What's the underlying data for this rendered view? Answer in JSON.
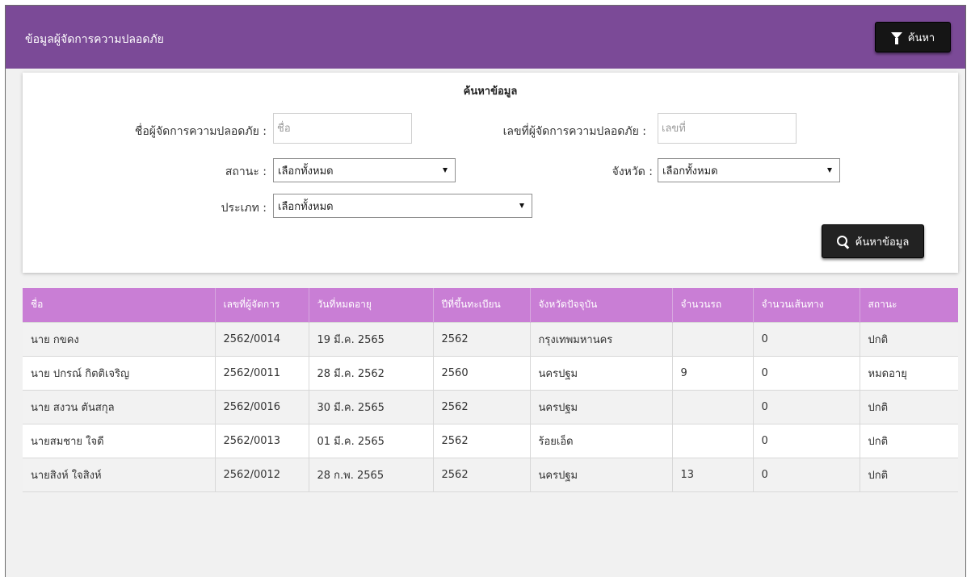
{
  "header": {
    "title": "ข้อมูลผู้จัดการความปลอดภัย",
    "filter_button": "ค้นหา"
  },
  "search": {
    "panel_title": "ค้นหาข้อมูล",
    "name_label": "ชื่อผู้จัดการความปลอดภัย :",
    "name_placeholder": "ชื่อ",
    "number_label": "เลขที่ผู้จัดการความปลอดภัย :",
    "number_placeholder": "เลขที่",
    "status_label": "สถานะ :",
    "status_value": "เลือกทั้งหมด",
    "province_label": "จังหวัด :",
    "province_value": "เลือกทั้งหมด",
    "type_label": "ประเภท :",
    "type_value": "เลือกทั้งหมด",
    "search_button": "ค้นหาข้อมูล"
  },
  "table": {
    "headers": [
      "ชื่อ",
      "เลขที่ผู้จัดการ",
      "วันที่หมดอายุ",
      "ปีที่ขึ้นทะเบียน",
      "จังหวัดปัจจุบัน",
      "จำนวนรถ",
      "จำนวนเส้นทาง",
      "สถานะ"
    ],
    "rows": [
      [
        "นาย กขคง",
        "2562/0014",
        "19 มี.ค. 2565",
        "2562",
        "กรุงเทพมหานคร",
        "",
        "0",
        "ปกติ"
      ],
      [
        "นาย ปกรณ์ กิตติเจริญ",
        "2562/0011",
        "28 มี.ค. 2562",
        "2560",
        "นครปฐม",
        "9",
        "0",
        "หมดอายุ"
      ],
      [
        "นาย สงวน ตันสกุล",
        "2562/0016",
        "30 มี.ค. 2565",
        "2562",
        "นครปฐม",
        "",
        "0",
        "ปกติ"
      ],
      [
        "นายสมชาย ใจดี",
        "2562/0013",
        "01 มี.ค. 2565",
        "2562",
        "ร้อยเอ็ด",
        "",
        "0",
        "ปกติ"
      ],
      [
        "นายสิงห์ ใจสิงห์",
        "2562/0012",
        "28 ก.พ. 2565",
        "2562",
        "นครปฐม",
        "13",
        "0",
        "ปกติ"
      ]
    ]
  }
}
